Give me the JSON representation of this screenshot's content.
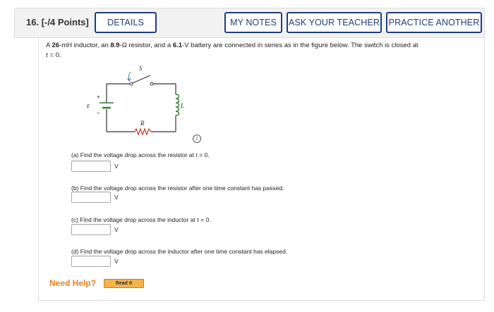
{
  "question": {
    "number": "16.",
    "points": "[-/4 Points]"
  },
  "buttons": {
    "details": "DETAILS",
    "my_notes": "MY NOTES",
    "ask_teacher": "ASK YOUR TEACHER",
    "practice_another": "PRACTICE ANOTHER"
  },
  "problem": {
    "p1": "A ",
    "inductance": "26",
    "p2": "-mH inductor, an ",
    "resistance": "8.9",
    "p3": "-Ω resistor, and a ",
    "voltage": "6.1",
    "p4": "-V battery are connected in series as in the figure below. The switch is closed at",
    "t_var": "t",
    "t_eq": " = 0."
  },
  "circuit": {
    "switch_label": "S",
    "emf_label": "ε",
    "plus": "+",
    "minus": "−",
    "resistor_label": "R",
    "inductor_label": "L",
    "info_glyph": "i"
  },
  "parts": [
    {
      "text_a": "(a) Find the voltage drop across the resistor at ",
      "var": "t",
      "text_b": " = 0.",
      "unit": "V"
    },
    {
      "text_a": "(b) Find the voltage drop across the resistor after one time constant has passed.",
      "var": "",
      "text_b": "",
      "unit": "V"
    },
    {
      "text_a": "(c) Find the voltage drop across the inductor at ",
      "var": "t",
      "text_b": " = 0.",
      "unit": "V"
    },
    {
      "text_a": "(d) Find the voltage drop across the inductor after one time constant has elapsed.",
      "var": "",
      "text_b": "",
      "unit": "V"
    }
  ],
  "help": {
    "need_help": "Need Help?",
    "read_it": "Read It"
  },
  "colors": {
    "button_border": "#1f3e7a",
    "need_help": "#e8821a",
    "read_it_bg": "#f6b347",
    "resistor": "#c0392b",
    "inductor": "#2e7d32"
  }
}
